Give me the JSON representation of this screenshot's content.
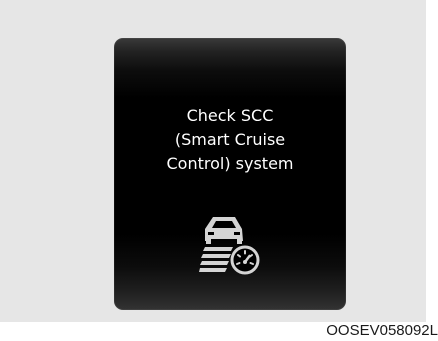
{
  "cluster_display": {
    "message_lines": [
      "Check SCC",
      "(Smart Cruise",
      "Control) system"
    ],
    "icon": "scc-warning-icon"
  },
  "figure_code": "OOSEV058092L"
}
